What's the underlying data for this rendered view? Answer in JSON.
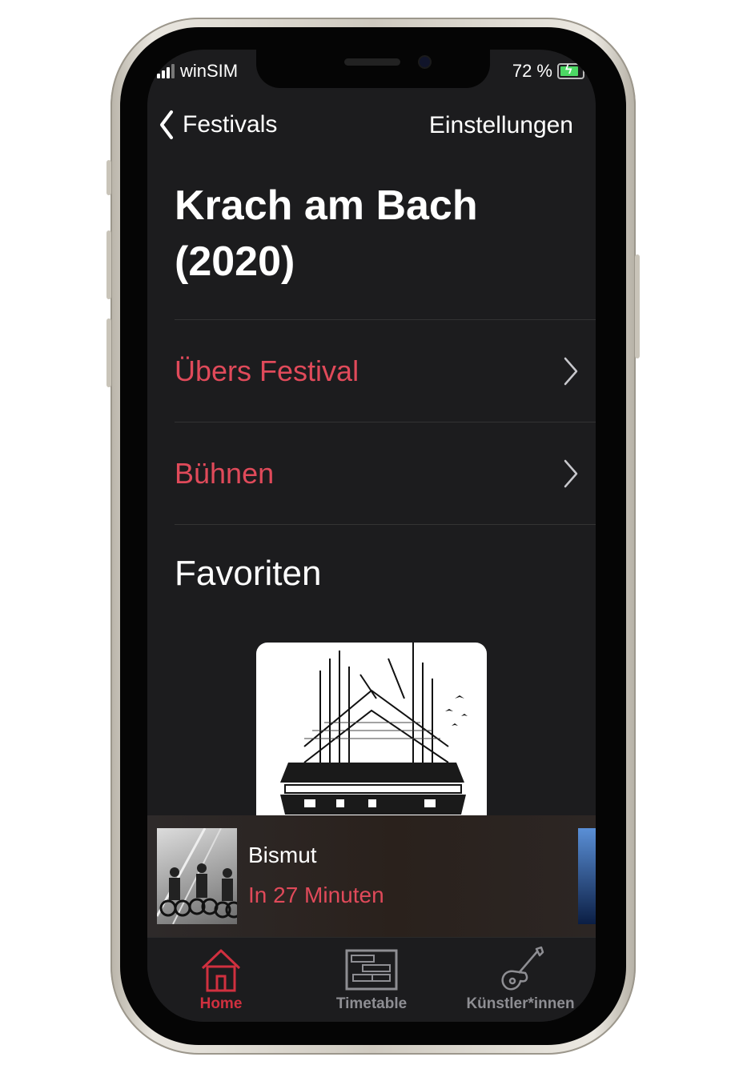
{
  "status_bar": {
    "carrier": "winSIM",
    "battery_text": "72 %",
    "battery_level": 0.72,
    "colors": {
      "battery": "#4cd964"
    }
  },
  "nav": {
    "back_label": "Festivals",
    "right_label": "Einstellungen"
  },
  "page": {
    "title_line1": "Krach am Bach",
    "title_line2": "(2020)"
  },
  "menu": {
    "items": [
      {
        "label": "Übers Festival",
        "icon": "chevron-right-icon"
      },
      {
        "label": "Bühnen",
        "icon": "chevron-right-icon"
      }
    ]
  },
  "favorites": {
    "heading": "Favoriten",
    "artwork_icon": "building-sketch-icon"
  },
  "now_playing": {
    "artist": "Bismut",
    "time_text": "In 27 Minuten",
    "thumb_icon": "band-photo-icon"
  },
  "tabbar": {
    "tabs": [
      {
        "label": "Home",
        "icon": "home-icon",
        "active": true
      },
      {
        "label": "Timetable",
        "icon": "timetable-icon",
        "active": false
      },
      {
        "label": "Künstler*innen",
        "icon": "guitar-icon",
        "active": false
      }
    ]
  },
  "colors": {
    "accent": "#e04a5a",
    "tab_active": "#d0303f",
    "background": "#1c1c1e"
  }
}
